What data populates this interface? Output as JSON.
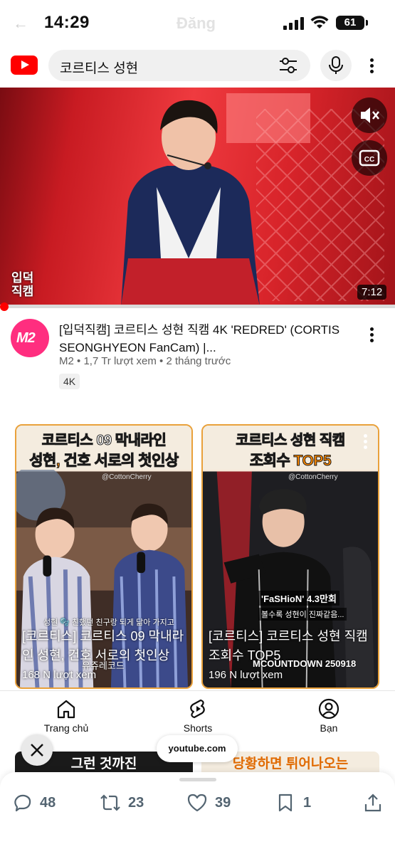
{
  "status_bar": {
    "time": "14:29",
    "battery": "61",
    "ghost_title": "Đăng"
  },
  "search": {
    "query": "코르티스 성현"
  },
  "video": {
    "badge_line1": "입덕",
    "badge_line2": "직캠",
    "duration": "7:12",
    "title": "[입덕직캠] 코르티스 성현 직캠 4K 'REDRED' (CORTIS SEONGHYEON FanCam) |...",
    "channel": "M2",
    "views": "1,7 Tr lượt xem",
    "age": "2 tháng trước",
    "meta_sep": "•",
    "tag": "4K",
    "channel_logo_text": "M2"
  },
  "shorts": [
    {
      "header_line1": "코르티스 09 막내라인",
      "header_line2": "성현, 건호 서로의 첫인상",
      "watermark": "@CottonCherry",
      "subtitle": "성현 🫧 친했던 친구랑 되게 닮아 가지고",
      "caption": "[코르티스] 코르티스 09 막내라인 성현, 건호 서로의 첫인상",
      "overlay_label": "유쥬레코드",
      "views": "168 N lượt xem"
    },
    {
      "header_line1": "코르티스 성현 직캠",
      "header_line2": "조회수 TOP5",
      "watermark": "@CottonCherry",
      "subtitle": "'FaSHioN' 4.3만회",
      "subtitle2": "볼수록 성현이 진짜같음...",
      "caption": "[코르티스] 코르티스 성현 직캠 조회수 TOP5",
      "overlay_label": "MCOUNTDOWN 250918",
      "views": "196 N lượt xem"
    }
  ],
  "nav": {
    "home": "Trang chủ",
    "shorts": "Shorts",
    "you": "Bạn"
  },
  "peek": {
    "left_text": "그런 것까진",
    "right_text": "당황하면 튀어나오는"
  },
  "browser": {
    "url": "youtube.com"
  },
  "tweet_actions": {
    "replies": "48",
    "retweets": "23",
    "likes": "39",
    "bookmarks": "1"
  }
}
